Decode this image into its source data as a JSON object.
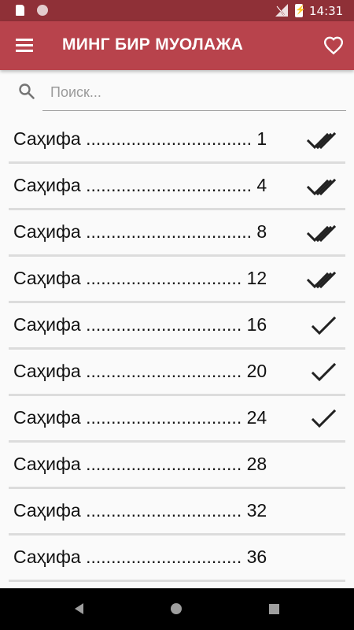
{
  "status_bar": {
    "time": "14:31"
  },
  "app_bar": {
    "title": "МИНГ БИР МУОЛАЖА"
  },
  "search": {
    "placeholder": "Поиск..."
  },
  "list": {
    "items": [
      {
        "label": "Саҳифа ................................. 1",
        "status": "double-check-icon"
      },
      {
        "label": "Саҳифа ................................. 4",
        "status": "double-check-icon"
      },
      {
        "label": "Саҳифа ................................. 8",
        "status": "double-check-icon"
      },
      {
        "label": "Саҳифа ............................... 12",
        "status": "double-check-icon"
      },
      {
        "label": "Саҳифа ............................... 16",
        "status": "check-icon"
      },
      {
        "label": "Саҳифа ............................... 20",
        "status": "check-icon"
      },
      {
        "label": "Саҳифа ............................... 24",
        "status": "check-icon"
      },
      {
        "label": "Саҳифа ............................... 28",
        "status": ""
      },
      {
        "label": "Саҳифа ............................... 32",
        "status": ""
      },
      {
        "label": "Саҳифа ............................... 36",
        "status": ""
      }
    ]
  },
  "colors": {
    "status_bar": "#8f3037",
    "app_bar": "#b8434c",
    "background": "#fafafa",
    "divider": "#dcdcdc"
  }
}
